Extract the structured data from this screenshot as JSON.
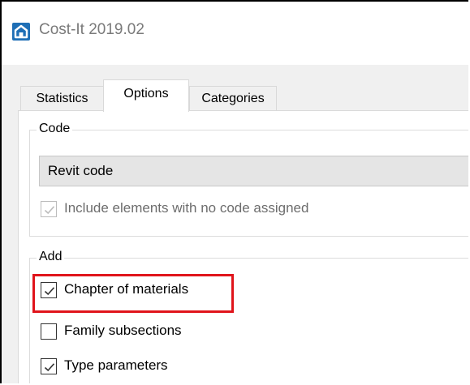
{
  "window": {
    "title": "Cost-It 2019.02",
    "icon": "cost-it-app-icon",
    "accent_color": "#1f6fb6"
  },
  "tabs": [
    {
      "label": "Statistics",
      "active": false
    },
    {
      "label": "Options",
      "active": true
    },
    {
      "label": "Categories",
      "active": false
    }
  ],
  "code_group": {
    "label": "Code",
    "selected_value": "Revit code",
    "include_unassigned": {
      "label": "Include elements with no code assigned",
      "checked": true,
      "enabled": false
    }
  },
  "add_group": {
    "label": "Add",
    "options": [
      {
        "label": "Chapter of materials",
        "checked": true,
        "highlighted": true
      },
      {
        "label": "Family subsections",
        "checked": false,
        "highlighted": false
      },
      {
        "label": "Type parameters",
        "checked": true,
        "highlighted": false
      }
    ]
  },
  "highlight_color": "#e0141b"
}
